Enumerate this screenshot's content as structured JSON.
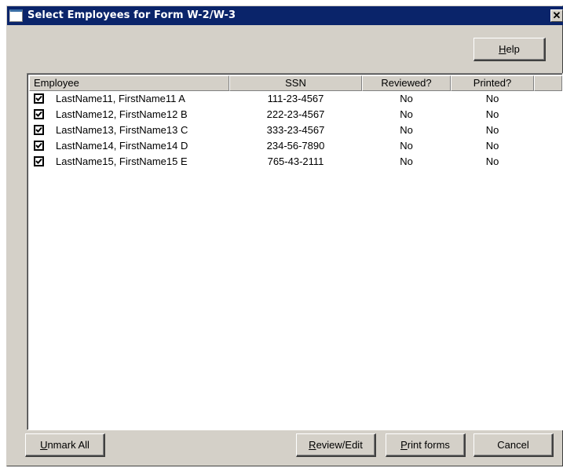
{
  "window": {
    "title": "Select Employees for Form W-2/W-3",
    "close_glyph": "✕"
  },
  "buttons": {
    "help": {
      "label": "Help",
      "mnemonic": "H",
      "rest": "elp"
    },
    "unmark_all": {
      "label": "Unmark All",
      "mnemonic": "U",
      "rest": "nmark All"
    },
    "review_edit": {
      "label": "Review/Edit",
      "mnemonic": "R",
      "rest": "eview/Edit"
    },
    "print_forms": {
      "label": "Print forms",
      "mnemonic": "P",
      "rest": "rint forms"
    },
    "cancel": {
      "label": "Cancel"
    }
  },
  "table": {
    "columns": [
      "Employee",
      "SSN",
      "Reviewed?",
      "Printed?"
    ],
    "rows": [
      {
        "checked": true,
        "employee": "LastName11, FirstName11 A",
        "ssn": "111-23-4567",
        "reviewed": "No",
        "printed": "No"
      },
      {
        "checked": true,
        "employee": "LastName12, FirstName12 B",
        "ssn": "222-23-4567",
        "reviewed": "No",
        "printed": "No"
      },
      {
        "checked": true,
        "employee": "LastName13, FirstName13 C",
        "ssn": "333-23-4567",
        "reviewed": "No",
        "printed": "No"
      },
      {
        "checked": true,
        "employee": "LastName14, FirstName14 D",
        "ssn": "234-56-7890",
        "reviewed": "No",
        "printed": "No"
      },
      {
        "checked": true,
        "employee": "LastName15, FirstName15 E",
        "ssn": "765-43-2111",
        "reviewed": "No",
        "printed": "No"
      }
    ]
  },
  "colors": {
    "titlebar": "#0a246a",
    "face": "#d4d0c8",
    "list_bg": "#ffffff"
  },
  "icons": {
    "app": "window-icon",
    "close": "close-icon",
    "check": "checkmark-icon"
  }
}
